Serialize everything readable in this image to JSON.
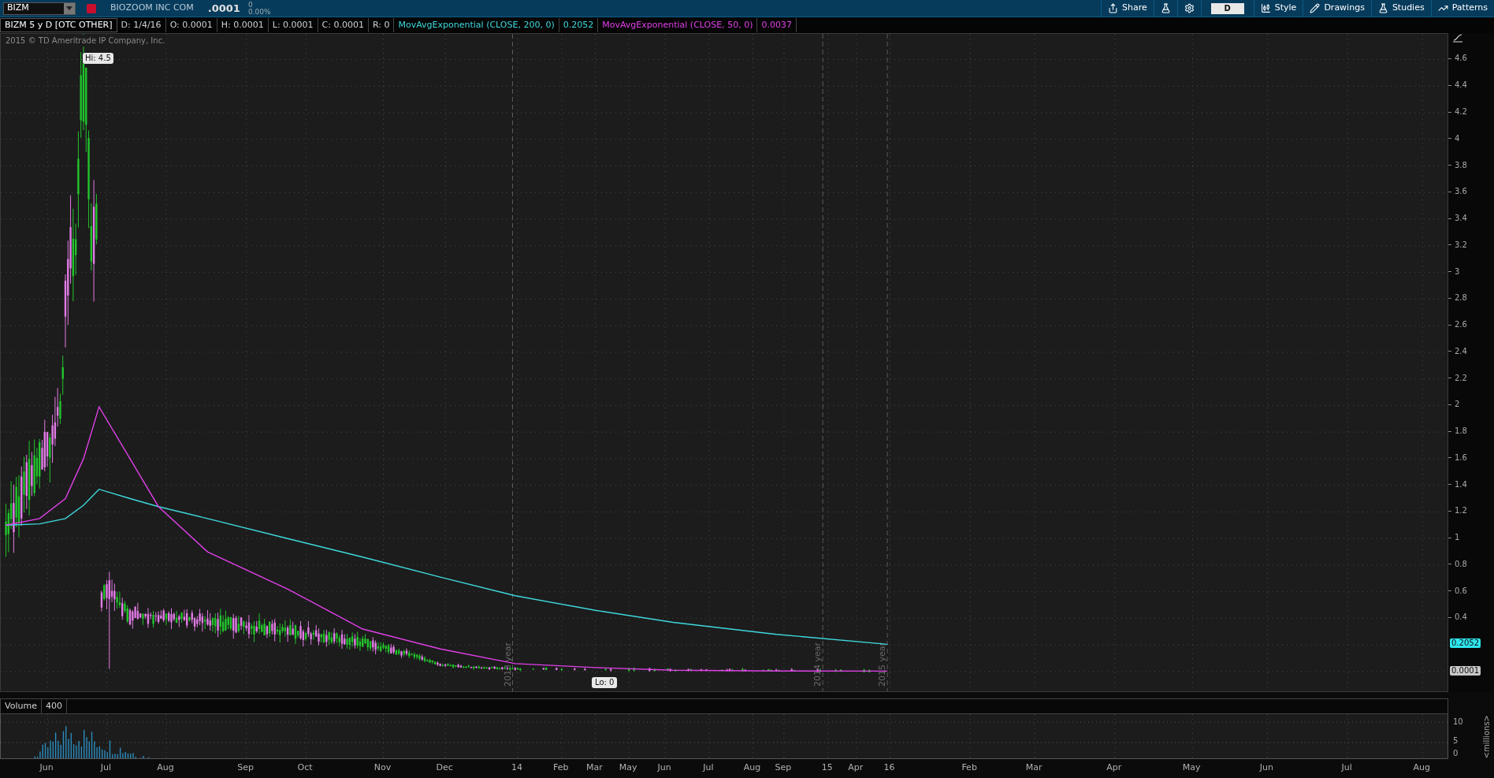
{
  "toolbar": {
    "symbol": "BIZM",
    "company": "BIOZOOM INC COM",
    "last": ".0001",
    "change": "0",
    "change_percent": "0.00%",
    "aggregation": "D",
    "buttons": [
      {
        "label": "Share",
        "kind": "share"
      },
      {
        "label": "Style",
        "kind": "style"
      },
      {
        "label": "Drawings",
        "kind": "drawings"
      },
      {
        "label": "Studies",
        "kind": "studies"
      },
      {
        "label": "Patterns",
        "kind": "patterns"
      }
    ]
  },
  "info_bar": {
    "title": "BIZM 5 y D [OTC OTHER]",
    "fields": [
      "D: 1/4/16",
      "O: 0.0001",
      "H: 0.0001",
      "L: 0.0001",
      "C: 0.0001",
      "R: 0"
    ],
    "studies": [
      {
        "label": "MovAvgExponential (CLOSE, 200, 0)",
        "value": "0.2052",
        "color": "#3fd8dc"
      },
      {
        "label": "MovAvgExponential (CLOSE, 50, 0)",
        "value": "0.0037",
        "color": "#e040e8"
      }
    ]
  },
  "copyright": "2015 © TD Ameritrade IP Company, Inc.",
  "price_chart": {
    "hi_label": "Hi: 4.5",
    "lo_label": "Lo: 0",
    "year_labels": [
      "2013 year",
      "2014 year",
      "2015 year"
    ],
    "badges": [
      {
        "value": "0.2052",
        "color": "#2fe6ee"
      },
      {
        "value": "0.0001",
        "color": "#c8c8c8"
      }
    ],
    "axis_labels": [
      "4.6",
      "4.4",
      "4.2",
      "4",
      "3.8",
      "3.6",
      "3.4",
      "3.2",
      "3",
      "2.8",
      "2.6",
      "2.4",
      "2.2",
      "2",
      "1.8",
      "1.6",
      "1.4",
      "1.2",
      "1",
      "0.8",
      "0.6",
      "0.4"
    ]
  },
  "date_labels": [
    "Jun",
    "Jul",
    "Aug",
    "Sep",
    "Oct",
    "Nov",
    "Dec",
    "14",
    "Feb",
    "Mar",
    "May",
    "Jun",
    "Jul",
    "Aug",
    "Sep",
    "15",
    "Apr",
    "16",
    "Feb",
    "Mar",
    "Apr",
    "May",
    "Jun",
    "Jul",
    "Aug"
  ],
  "volume_panel": {
    "title": "Volume",
    "value": "400",
    "yticks": [
      "10",
      "5",
      "0"
    ],
    "unit": "<millions>"
  }
}
